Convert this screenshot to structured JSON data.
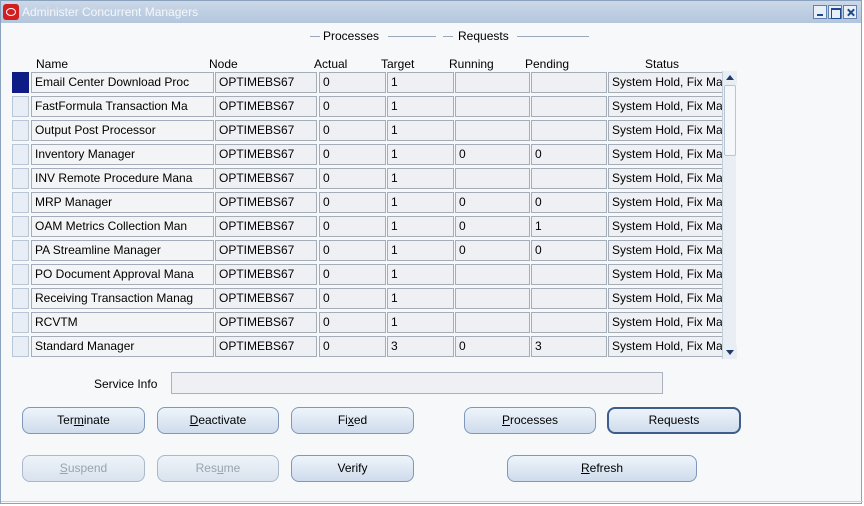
{
  "window": {
    "title": "Administer Concurrent Managers"
  },
  "groups": {
    "processes": "Processes",
    "requests": "Requests"
  },
  "columns": {
    "name": "Name",
    "node": "Node",
    "actual": "Actual",
    "target": "Target",
    "running": "Running",
    "pending": "Pending",
    "status": "Status"
  },
  "rows": [
    {
      "name": "Email Center Download Proc",
      "node": "OPTIMEBS67",
      "actual": "0",
      "target": "1",
      "running": "",
      "pending": "",
      "status": "System Hold, Fix Ma"
    },
    {
      "name": "FastFormula Transaction Ma",
      "node": "OPTIMEBS67",
      "actual": "0",
      "target": "1",
      "running": "",
      "pending": "",
      "status": "System Hold, Fix Ma"
    },
    {
      "name": "Output Post Processor",
      "node": "OPTIMEBS67",
      "actual": "0",
      "target": "1",
      "running": "",
      "pending": "",
      "status": "System Hold, Fix Ma"
    },
    {
      "name": "Inventory Manager",
      "node": "OPTIMEBS67",
      "actual": "0",
      "target": "1",
      "running": "0",
      "pending": "0",
      "status": "System Hold, Fix Ma"
    },
    {
      "name": "INV Remote Procedure Mana",
      "node": "OPTIMEBS67",
      "actual": "0",
      "target": "1",
      "running": "",
      "pending": "",
      "status": "System Hold, Fix Ma"
    },
    {
      "name": "MRP Manager",
      "node": "OPTIMEBS67",
      "actual": "0",
      "target": "1",
      "running": "0",
      "pending": "0",
      "status": "System Hold, Fix Ma"
    },
    {
      "name": "OAM Metrics Collection Man",
      "node": "OPTIMEBS67",
      "actual": "0",
      "target": "1",
      "running": "0",
      "pending": "1",
      "status": "System Hold, Fix Ma"
    },
    {
      "name": "PA Streamline Manager",
      "node": "OPTIMEBS67",
      "actual": "0",
      "target": "1",
      "running": "0",
      "pending": "0",
      "status": "System Hold, Fix Ma"
    },
    {
      "name": "PO Document Approval Mana",
      "node": "OPTIMEBS67",
      "actual": "0",
      "target": "1",
      "running": "",
      "pending": "",
      "status": "System Hold, Fix Ma"
    },
    {
      "name": "Receiving Transaction Manag",
      "node": "OPTIMEBS67",
      "actual": "0",
      "target": "1",
      "running": "",
      "pending": "",
      "status": "System Hold, Fix Ma"
    },
    {
      "name": "RCVTM",
      "node": "OPTIMEBS67",
      "actual": "0",
      "target": "1",
      "running": "",
      "pending": "",
      "status": "System Hold, Fix Ma"
    },
    {
      "name": "Standard Manager",
      "node": "OPTIMEBS67",
      "actual": "0",
      "target": "3",
      "running": "0",
      "pending": "3",
      "status": "System Hold, Fix Ma"
    }
  ],
  "service_info": {
    "label": "Service Info",
    "value": ""
  },
  "buttons": {
    "terminate": {
      "pre": "Ter",
      "key": "m",
      "post": "inate"
    },
    "deactivate": {
      "pre": "",
      "key": "D",
      "post": "eactivate"
    },
    "fixed": {
      "pre": "Fi",
      "key": "x",
      "post": "ed"
    },
    "processes": {
      "pre": "",
      "key": "P",
      "post": "rocesses"
    },
    "requests": {
      "pre": "Requests",
      "key": "",
      "post": ""
    },
    "suspend": {
      "pre": "",
      "key": "S",
      "post": "uspend"
    },
    "resume": {
      "pre": "Res",
      "key": "u",
      "post": "me"
    },
    "verify": {
      "pre": "Verify",
      "key": "",
      "post": ""
    },
    "refresh": {
      "pre": "",
      "key": "R",
      "post": "efresh"
    }
  },
  "colors": {
    "current_row_indicator": "#0e1c86",
    "titlebar": "#b3c6dd",
    "button_face": "#cfdcec"
  }
}
